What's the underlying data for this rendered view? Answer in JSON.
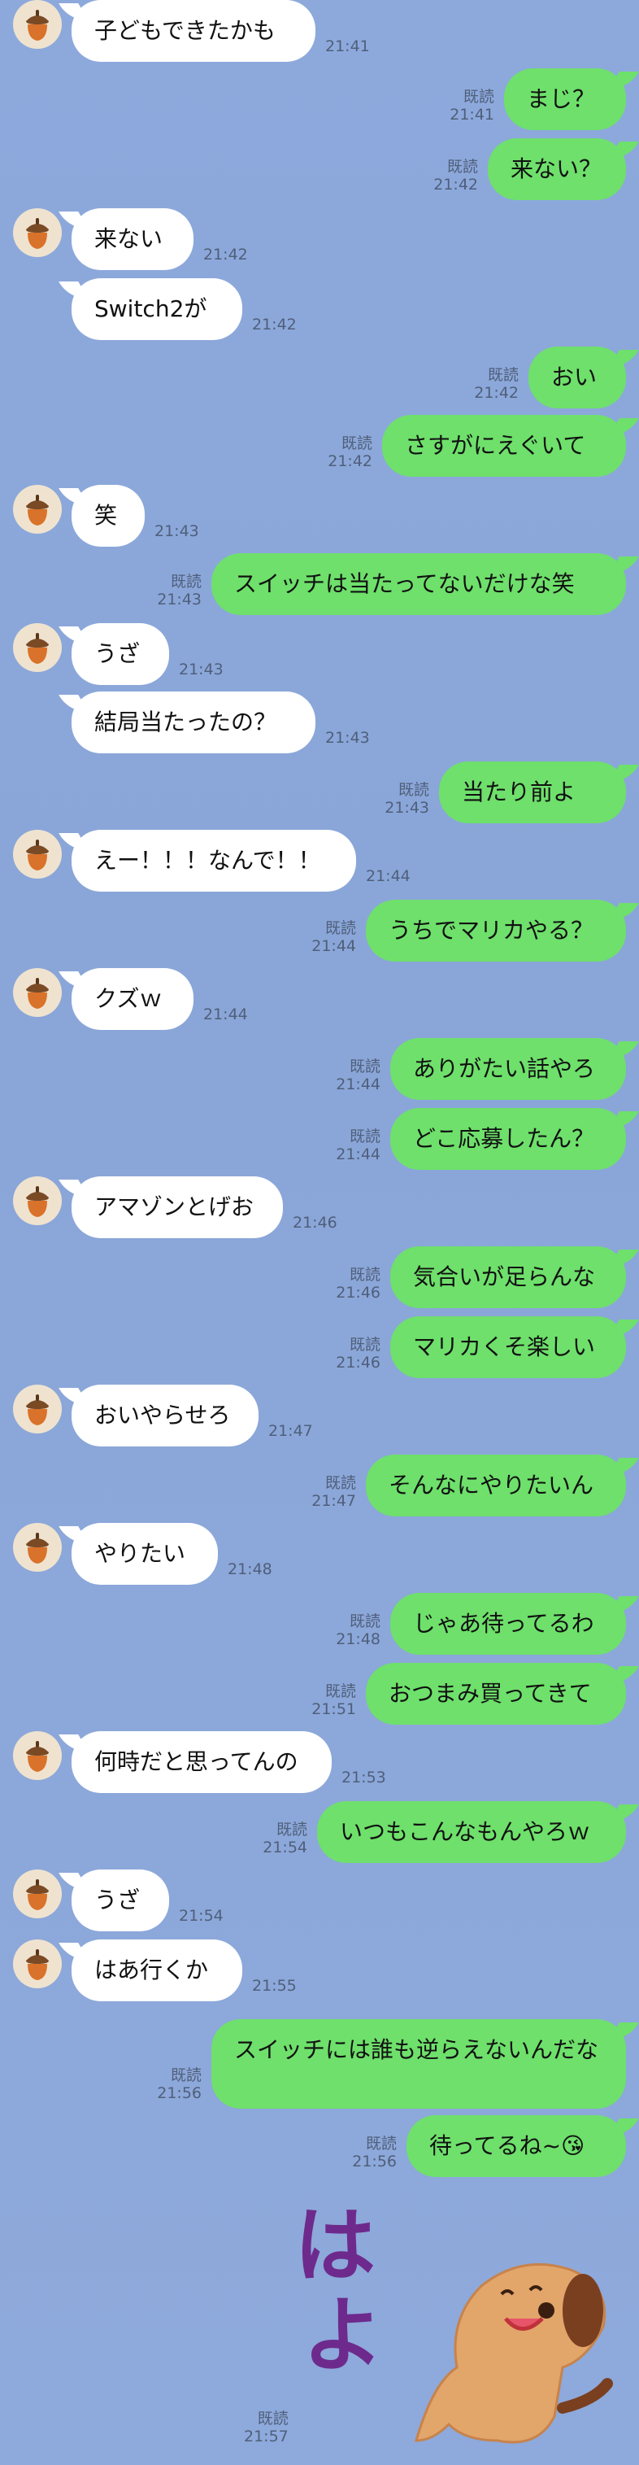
{
  "read_label": "既読",
  "messages": [
    {
      "side": "in",
      "text": "子どもできたかも",
      "time": "21:41"
    },
    {
      "side": "out",
      "text": "まじ？",
      "time": "21:41"
    },
    {
      "side": "out",
      "text": "来ない？",
      "time": "21:42"
    },
    {
      "side": "in",
      "text": "来ない",
      "time": "21:42"
    },
    {
      "side": "in",
      "text": "Switch2が",
      "time": "21:42"
    },
    {
      "side": "out",
      "text": "おい",
      "time": "21:42"
    },
    {
      "side": "out",
      "text": "さすがにえぐいて",
      "time": "21:42"
    },
    {
      "side": "in",
      "text": "笑",
      "time": "21:43"
    },
    {
      "side": "out",
      "text": "スイッチは当たってないだけな笑",
      "time": "21:43"
    },
    {
      "side": "in",
      "text": "うざ",
      "time": "21:43"
    },
    {
      "side": "in",
      "text": "結局当たったの？",
      "time": "21:43"
    },
    {
      "side": "out",
      "text": "当たり前よ",
      "time": "21:43"
    },
    {
      "side": "in",
      "text": "えー！！！なんで！！",
      "time": "21:44"
    },
    {
      "side": "out",
      "text": "うちでマリカやる？",
      "time": "21:44"
    },
    {
      "side": "in",
      "text": "クズｗ",
      "time": "21:44"
    },
    {
      "side": "out",
      "text": "ありがたい話やろ",
      "time": "21:44"
    },
    {
      "side": "out",
      "text": "どこ応募したん？",
      "time": "21:44"
    },
    {
      "side": "in",
      "text": "アマゾンとげお",
      "time": "21:46"
    },
    {
      "side": "out",
      "text": "気合いが足らんな",
      "time": "21:46"
    },
    {
      "side": "out",
      "text": "マリカくそ楽しい",
      "time": "21:46"
    },
    {
      "side": "in",
      "text": "おいやらせろ",
      "time": "21:47"
    },
    {
      "side": "out",
      "text": "そんなにやりたいん",
      "time": "21:47"
    },
    {
      "side": "in",
      "text": "やりたい",
      "time": "21:48"
    },
    {
      "side": "out",
      "text": "じゃあ待ってるわ",
      "time": "21:48"
    },
    {
      "side": "out",
      "text": "おつまみ買ってきて",
      "time": "21:51"
    },
    {
      "side": "in",
      "text": "何時だと思ってんの",
      "time": "21:53"
    },
    {
      "side": "out",
      "text": "いつもこんなもんやろｗ",
      "time": "21:54"
    },
    {
      "side": "in",
      "text": "うざ",
      "time": "21:54"
    },
    {
      "side": "in",
      "text": "はあ行くか",
      "time": "21:55"
    },
    {
      "side": "out",
      "text": "スイッチには誰も逆らえないんだな",
      "time": "21:56"
    },
    {
      "side": "out",
      "text": "待ってるね~😘",
      "time": "21:56"
    }
  ],
  "sticker": {
    "text": "はよ",
    "time": "21:57"
  }
}
